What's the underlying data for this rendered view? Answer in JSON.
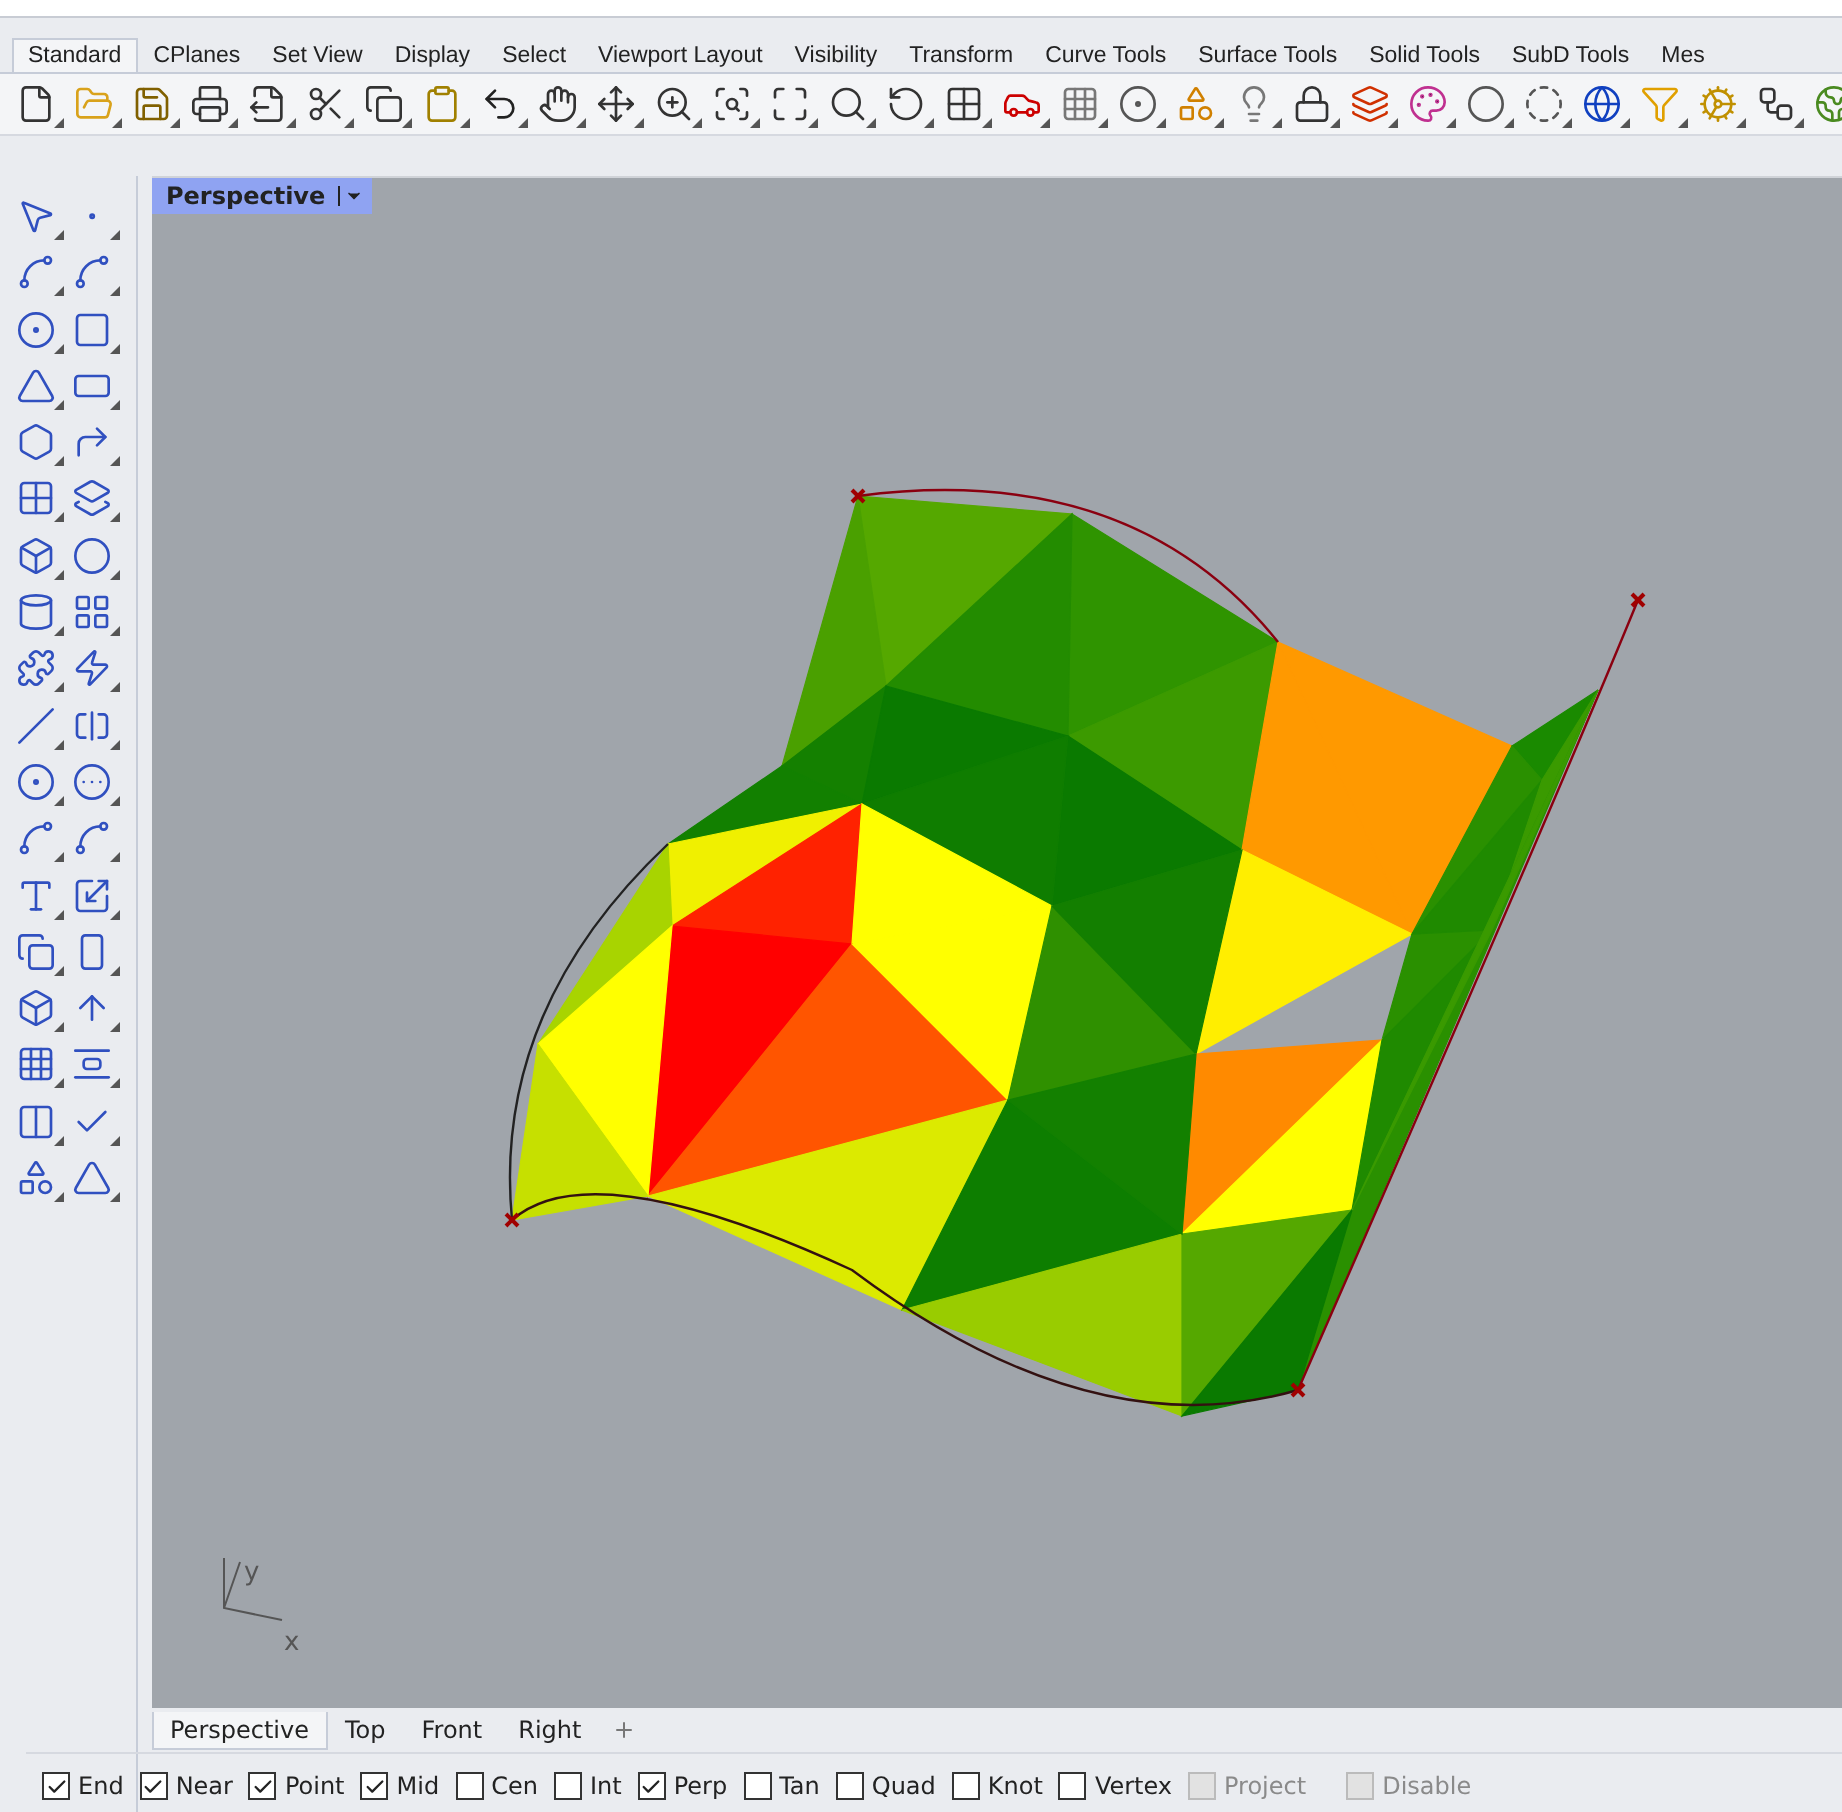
{
  "ribbon_tabs": [
    {
      "label": "Standard",
      "selected": true
    },
    {
      "label": "CPlanes",
      "selected": false
    },
    {
      "label": "Set View",
      "selected": false
    },
    {
      "label": "Display",
      "selected": false
    },
    {
      "label": "Select",
      "selected": false
    },
    {
      "label": "Viewport Layout",
      "selected": false
    },
    {
      "label": "Visibility",
      "selected": false
    },
    {
      "label": "Transform",
      "selected": false
    },
    {
      "label": "Curve Tools",
      "selected": false
    },
    {
      "label": "Surface Tools",
      "selected": false
    },
    {
      "label": "Solid Tools",
      "selected": false
    },
    {
      "label": "SubD Tools",
      "selected": false
    },
    {
      "label": "Mes",
      "selected": false
    }
  ],
  "viewport": {
    "title": "Perspective",
    "axes": [
      "y",
      "x"
    ]
  },
  "viewport_tabs": [
    {
      "label": "Perspective",
      "selected": true
    },
    {
      "label": "Top",
      "selected": false
    },
    {
      "label": "Front",
      "selected": false
    },
    {
      "label": "Right",
      "selected": false
    }
  ],
  "osnaps": [
    {
      "label": "End",
      "checked": true,
      "disabled": false
    },
    {
      "label": "Near",
      "checked": true,
      "disabled": false
    },
    {
      "label": "Point",
      "checked": true,
      "disabled": false
    },
    {
      "label": "Mid",
      "checked": true,
      "disabled": false
    },
    {
      "label": "Cen",
      "checked": false,
      "disabled": false
    },
    {
      "label": "Int",
      "checked": false,
      "disabled": false
    },
    {
      "label": "Perp",
      "checked": true,
      "disabled": false
    },
    {
      "label": "Tan",
      "checked": false,
      "disabled": false
    },
    {
      "label": "Quad",
      "checked": false,
      "disabled": false
    },
    {
      "label": "Knot",
      "checked": false,
      "disabled": false
    },
    {
      "label": "Vertex",
      "checked": false,
      "disabled": false
    },
    {
      "label": "Project",
      "checked": false,
      "disabled": true
    },
    {
      "label": "Disable",
      "checked": false,
      "disabled": true
    }
  ]
}
